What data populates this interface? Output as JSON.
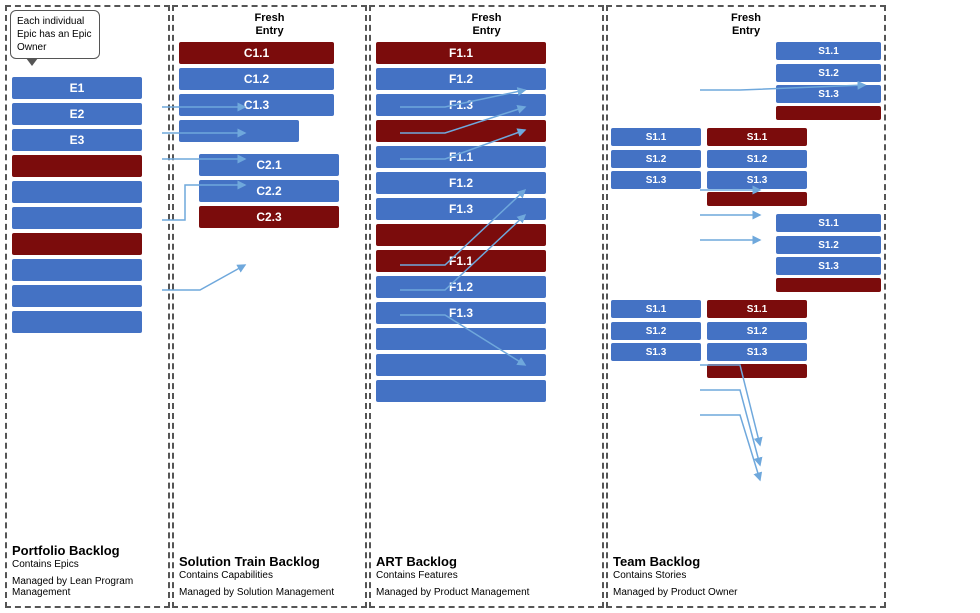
{
  "speech_bubble": "Each individual Epic has an Epic Owner",
  "columns": {
    "portfolio": {
      "fresh_entry": null,
      "title": "Portfolio Backlog",
      "subtitle": "Contains Epics",
      "managed": "Managed by Lean Program Management",
      "bars": [
        {
          "label": "E1",
          "color": "blue"
        },
        {
          "label": "E2",
          "color": "blue"
        },
        {
          "label": "E3",
          "color": "blue"
        },
        {
          "label": "",
          "color": "dark-red"
        },
        {
          "label": "",
          "color": "blue"
        },
        {
          "label": "",
          "color": "blue"
        },
        {
          "label": "",
          "color": "dark-red"
        },
        {
          "label": "",
          "color": "blue"
        },
        {
          "label": "",
          "color": "blue"
        },
        {
          "label": "",
          "color": "blue"
        }
      ]
    },
    "solution": {
      "fresh_entry": "Fresh\nEntry",
      "title": "Solution Train Backlog",
      "subtitle": "Contains Capabilities",
      "managed": "Managed by Solution\nManagement",
      "group1": [
        {
          "label": "C1.1",
          "color": "dark-red"
        },
        {
          "label": "C1.2",
          "color": "blue"
        },
        {
          "label": "C1.3",
          "color": "blue"
        },
        {
          "label": "",
          "color": "blue"
        }
      ],
      "group2": [
        {
          "label": "C2.1",
          "color": "blue"
        },
        {
          "label": "C2.2",
          "color": "blue"
        },
        {
          "label": "C2.3",
          "color": "dark-red"
        }
      ]
    },
    "art": {
      "fresh_entry": "Fresh\nEntry",
      "title": "ART Backlog",
      "subtitle": "Contains Features",
      "managed": "Managed by Product\nManagement",
      "group1": [
        {
          "label": "F1.1",
          "color": "dark-red"
        },
        {
          "label": "F1.2",
          "color": "blue"
        },
        {
          "label": "F1.3",
          "color": "blue"
        },
        {
          "label": "",
          "color": "dark-red"
        }
      ],
      "group2": [
        {
          "label": "F1.1",
          "color": "blue"
        },
        {
          "label": "F1.2",
          "color": "blue"
        },
        {
          "label": "F1.3",
          "color": "blue"
        },
        {
          "label": "",
          "color": "dark-red"
        }
      ],
      "group3": [
        {
          "label": "F1.1",
          "color": "dark-red"
        },
        {
          "label": "F1.2",
          "color": "blue"
        },
        {
          "label": "F1.3",
          "color": "blue"
        },
        {
          "label": "",
          "color": "blue"
        },
        {
          "label": "",
          "color": "blue"
        },
        {
          "label": "",
          "color": "blue"
        }
      ]
    },
    "team": {
      "fresh_entry": "Fresh\nEntry",
      "title": "Team  Backlog",
      "subtitle": "Contains Stories",
      "managed": "Managed by Product Owner",
      "group1_right": [
        {
          "label": "S1.1",
          "color": "blue"
        },
        {
          "label": "S1.2",
          "color": "blue"
        },
        {
          "label": "S1.3",
          "color": "blue"
        },
        {
          "label": "",
          "color": "dark-red"
        }
      ],
      "group2_left": [
        {
          "label": "S1.1",
          "color": "blue"
        },
        {
          "label": "S1.2",
          "color": "blue"
        },
        {
          "label": "S1.3",
          "color": "blue"
        }
      ],
      "group2_right": [
        {
          "label": "S1.1",
          "color": "dark-red"
        },
        {
          "label": "S1.2",
          "color": "blue"
        },
        {
          "label": "S1.3",
          "color": "blue"
        },
        {
          "label": "",
          "color": "dark-red"
        }
      ],
      "group3": [
        {
          "label": "S1.1",
          "color": "blue"
        },
        {
          "label": "S1.2",
          "color": "blue"
        },
        {
          "label": "S1.3",
          "color": "blue"
        },
        {
          "label": "",
          "color": "dark-red"
        }
      ],
      "group4_left": [
        {
          "label": "S1.1",
          "color": "blue"
        },
        {
          "label": "S1.2",
          "color": "blue"
        },
        {
          "label": "S1.3",
          "color": "blue"
        }
      ],
      "group4_right": [
        {
          "label": "S1.1",
          "color": "dark-red"
        },
        {
          "label": "S1.2",
          "color": "blue"
        },
        {
          "label": "S1.3",
          "color": "blue"
        },
        {
          "label": "",
          "color": "dark-red"
        }
      ]
    }
  }
}
